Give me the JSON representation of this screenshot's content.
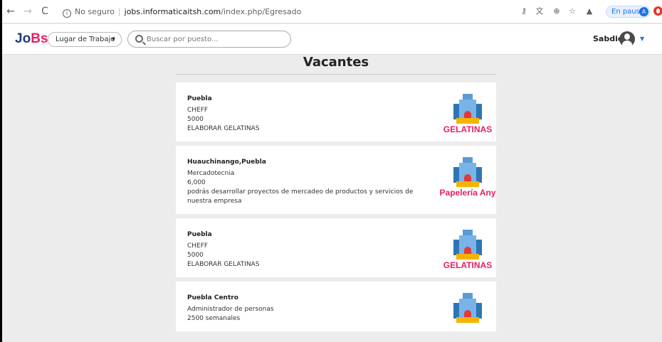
{
  "browser": {
    "url_security": "No seguro",
    "url_host": "jobs.informaticaitsh.com",
    "url_path": "/index.php/Egresado",
    "pause_label": "En pausa",
    "profile_initial": "A"
  },
  "navbar": {
    "logo_part1": "Jo",
    "logo_part2": "Bs",
    "workplace_select": "Lugar de Trabajo",
    "search_placeholder": "Buscar por puesto...",
    "user_name": "Sabdiel"
  },
  "page": {
    "title": "Vacantes"
  },
  "vacancies": [
    {
      "location": "Puebla",
      "position": "CHEFF",
      "salary": "5000",
      "description": "ELABORAR GELATINAS",
      "company": "GELATINAS"
    },
    {
      "location": "Huauchinango,Puebla",
      "position": "Mercadotecnia",
      "salary": "6,000",
      "description": "podrás desarrollar proyectos de mercadeo de productos y servicios de nuestra empresa",
      "company": "Papelería Any"
    },
    {
      "location": "Puebla",
      "position": "CHEFF",
      "salary": "5000",
      "description": "ELABORAR GELATINAS",
      "company": "GELATINAS"
    },
    {
      "location": "Puebla Centro",
      "position": "Administrador de personas",
      "salary": "2500 semanales",
      "description": "",
      "company": ""
    }
  ]
}
